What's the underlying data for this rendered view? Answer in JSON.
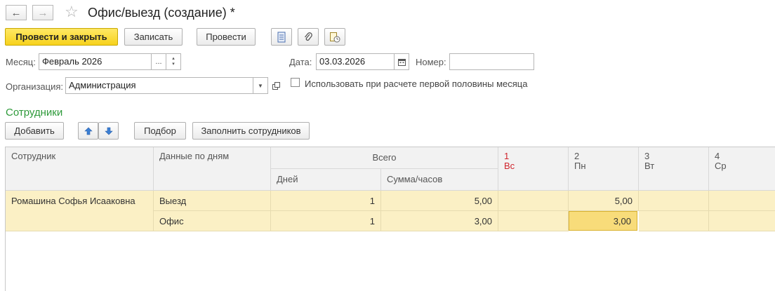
{
  "window": {
    "title": "Офис/выезд (создание) *"
  },
  "toolbar": {
    "post_close_label": "Провести и закрыть",
    "save_label": "Записать",
    "post_label": "Провести"
  },
  "form": {
    "month_label": "Месяц:",
    "month_value": "Февраль 2026",
    "month_choose_glyph": "...",
    "date_label": "Дата:",
    "date_value": "03.03.2026",
    "number_label": "Номер:",
    "number_value": "",
    "org_label": "Организация:",
    "org_value": "Администрация",
    "first_half_label": "Использовать при расчете первой половины месяца",
    "first_half_checked": false
  },
  "employees": {
    "section_title": "Сотрудники",
    "add_label": "Добавить",
    "pick_label": "Подбор",
    "fill_label": "Заполнить сотрудников"
  },
  "table": {
    "col_employee": "Сотрудник",
    "col_daydata": "Данные по дням",
    "col_total": "Всего",
    "col_days": "Дней",
    "col_sum": "Сумма/часов",
    "days": [
      {
        "num": "1",
        "wd": "Вс",
        "weekend": true
      },
      {
        "num": "2",
        "wd": "Пн",
        "weekend": false
      },
      {
        "num": "3",
        "wd": "Вт",
        "weekend": false
      },
      {
        "num": "4",
        "wd": "Ср",
        "weekend": false
      }
    ],
    "rows": [
      {
        "employee": "Ромашина Софья Исааковна",
        "type": "Выезд",
        "days": "1",
        "sum": "5,00",
        "d1": "",
        "d2": "5,00",
        "d3": "",
        "d4": ""
      },
      {
        "employee": "",
        "type": "Офис",
        "days": "1",
        "sum": "3,00",
        "d1": "",
        "d2": "3,00",
        "d3": "",
        "d4": ""
      }
    ]
  },
  "colors": {
    "accent_yellow": "#f7d21c",
    "section_green": "#2e9a3a",
    "weekend_red": "#d0262e",
    "row_highlight": "#fbf0c5"
  }
}
